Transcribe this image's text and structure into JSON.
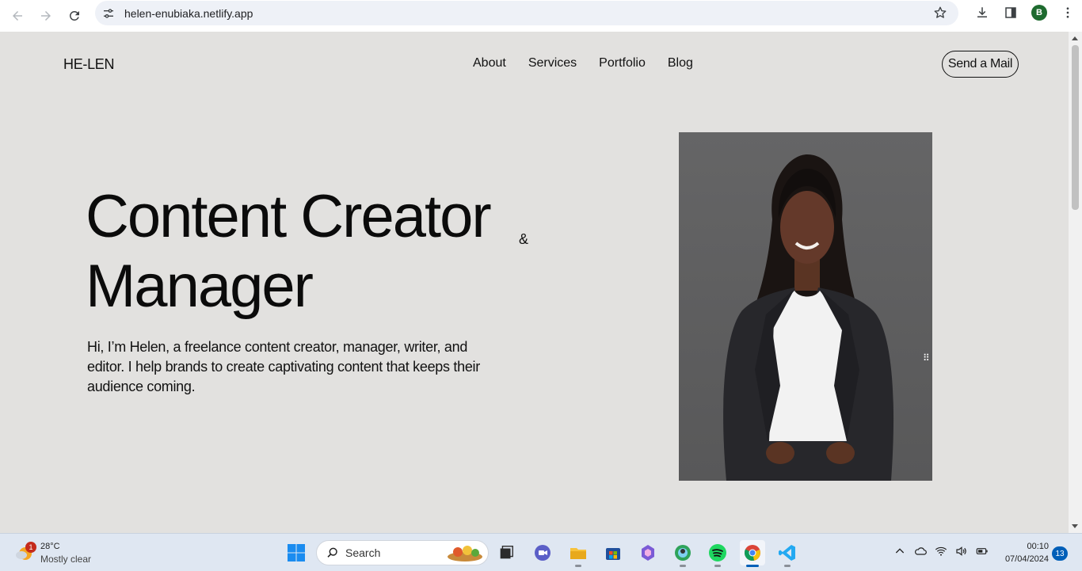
{
  "browser": {
    "url": "helen-enubiaka.netlify.app",
    "profile_initial": "B",
    "icons": [
      "back-icon",
      "forward-icon",
      "reload-icon",
      "site-settings-icon",
      "bookmark-star-icon",
      "downloads-icon",
      "side-panel-icon",
      "menu-icon"
    ]
  },
  "site": {
    "logo": "HE-LEN",
    "nav": [
      "About",
      "Services",
      "Portfolio",
      "Blog"
    ],
    "cta": "Send a Mail",
    "hero_line1": "Content Creator",
    "hero_amp": "&",
    "hero_line2": "Manager",
    "intro": "Hi, I’m Helen, a freelance content creator, manager, writer, and editor. I help brands to create captivating content that keeps their audience coming."
  },
  "taskbar": {
    "weather_badge": "1",
    "temperature": "28°C",
    "condition": "Mostly clear",
    "search_label": "Search",
    "apps": [
      "task-view-icon",
      "video-call-icon",
      "file-explorer-icon",
      "store-icon",
      "copilot-icon",
      "edge-profile-icon",
      "spotify-icon",
      "chrome-icon",
      "vscode-icon"
    ],
    "time": "00:10",
    "date": "07/04/2024",
    "notifications": "13"
  },
  "colors": {
    "page_bg": "#e2e1df",
    "text": "#111111",
    "taskbar_bg": "#dfe7f2",
    "accent": "#005fb8"
  }
}
